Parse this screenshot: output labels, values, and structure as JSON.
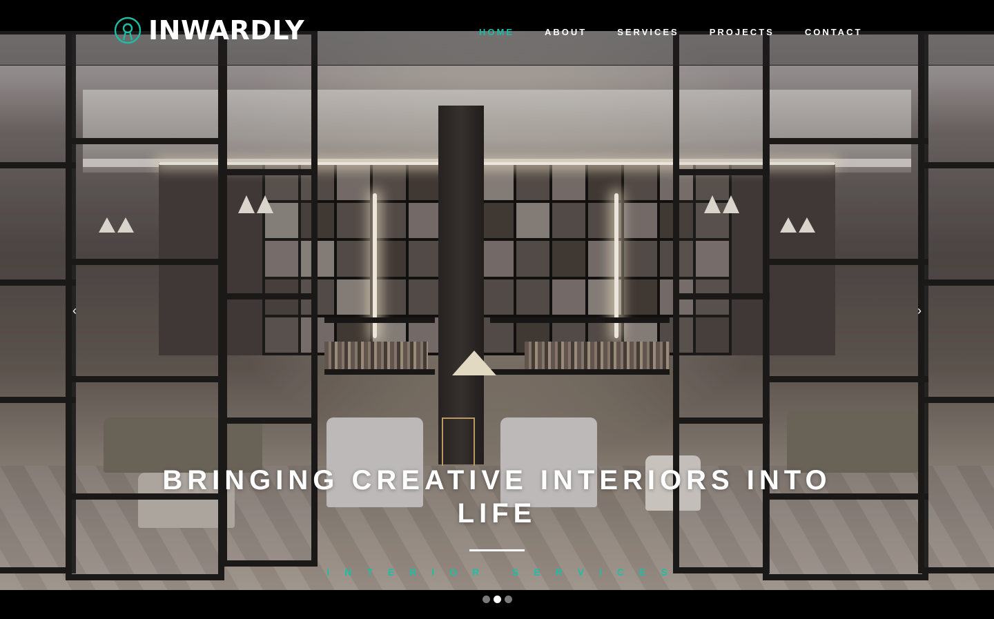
{
  "brand": {
    "name": "INWARDLY",
    "accent_color": "#1bbfa5",
    "logo_icon": "keyhole-circle-icon"
  },
  "nav": {
    "items": [
      {
        "label": "HOME",
        "active": true
      },
      {
        "label": "ABOUT",
        "active": false
      },
      {
        "label": "SERVICES",
        "active": false
      },
      {
        "label": "PROJECTS",
        "active": false
      },
      {
        "label": "CONTACT",
        "active": false
      }
    ]
  },
  "hero": {
    "headline": "BRINGING CREATIVE INTERIORS INTO LIFE",
    "subline": "INTERIOR SERVICES",
    "prev_icon": "chevron-left-icon",
    "next_icon": "chevron-right-icon",
    "prev_glyph": "‹",
    "next_glyph": "›"
  },
  "carousel": {
    "slide_count": 3,
    "active_index": 1
  }
}
